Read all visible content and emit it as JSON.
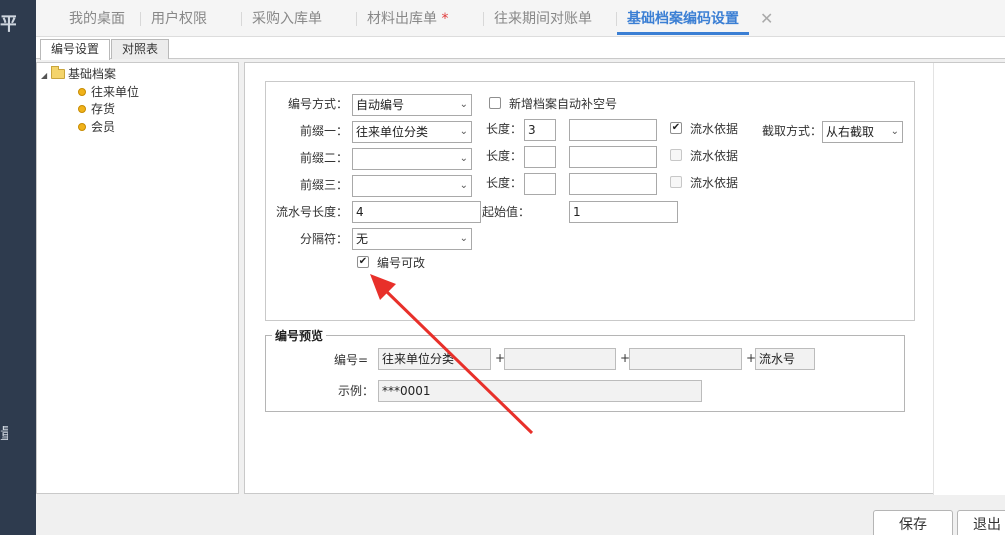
{
  "tabs": [
    {
      "label": "我的桌面",
      "active": false,
      "modified": false
    },
    {
      "label": "用户权限",
      "active": false,
      "modified": false
    },
    {
      "label": "采购入库单",
      "active": false,
      "modified": false
    },
    {
      "label": "材料出库单",
      "active": false,
      "modified": true,
      "modified_mark": "*"
    },
    {
      "label": "往来期间对账单",
      "active": false,
      "modified": false
    },
    {
      "label": "基础档案编码设置",
      "active": true,
      "modified": false,
      "close": "✕"
    }
  ],
  "subtabs": [
    {
      "label": "编号设置",
      "active": true
    },
    {
      "label": "对照表",
      "active": false
    }
  ],
  "tree": {
    "root": {
      "label": "基础档案",
      "toggle": "◢"
    },
    "children": [
      {
        "label": "往来单位",
        "selected": true
      },
      {
        "label": "存货",
        "selected": false
      },
      {
        "label": "会员",
        "selected": false
      }
    ]
  },
  "form": {
    "mode_label": "编号方式：",
    "mode_value": "自动编号",
    "autofill_label": "新增档案自动补空号",
    "autofill_checked": false,
    "prefix1_label": "前缀一：",
    "prefix1_value": "往来单位分类",
    "prefix2_label": "前缀二：",
    "prefix2_value": "",
    "prefix3_label": "前缀三：",
    "prefix3_value": "",
    "length_label": "长度：",
    "length1_value": "3",
    "length2_value": "",
    "length3_value": "",
    "serial_basis_label": "流水依据",
    "serial1_checked": true,
    "serial2_checked": false,
    "serial3_checked": false,
    "cut_label": "截取方式：",
    "cut_value": "从右截取",
    "serial_length_label": "流水号长度：",
    "serial_length_value": "4",
    "start_label": "起始值：",
    "start_value": "1",
    "separator_label": "分隔符：",
    "separator_value": "无",
    "editable_label": "编号可改",
    "editable_checked": true
  },
  "preview": {
    "legend": "编号预览",
    "code_label": "编号=",
    "part1": "往来单位分类",
    "part2": "",
    "part3": "",
    "part4": "流水号",
    "plus": "+",
    "example_label": "示例：",
    "example_value": "***0001"
  },
  "buttons": {
    "save": "保存",
    "exit": "退出"
  },
  "colors": {
    "accent": "#3b7fd4",
    "annotation_arrow": "#e8302a",
    "left_rail": "#2e3b4e"
  }
}
